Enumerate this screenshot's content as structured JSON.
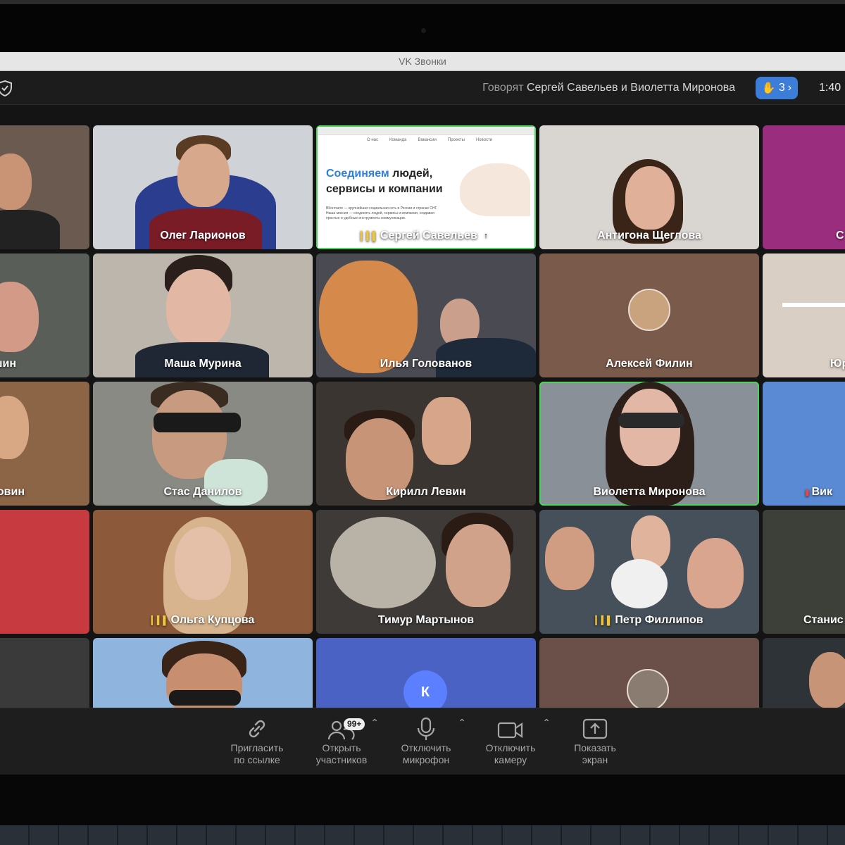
{
  "window": {
    "title": "VK Звонки"
  },
  "topbar": {
    "speaking_prefix": "Говорят",
    "speaking_names": "Сергей Савельев и Виолетта Миронова",
    "raised_hands_count": "3",
    "clock": "1:40"
  },
  "tiles": [
    {
      "name": "",
      "label": ""
    },
    {
      "name": "Олег Ларионов"
    },
    {
      "name": "Сергей Савельев",
      "sharing": true
    },
    {
      "name": "Антигона Щеглова"
    },
    {
      "name": "С"
    },
    {
      "name": "шин"
    },
    {
      "name": "Маша Мурина"
    },
    {
      "name": "Илья Голованов"
    },
    {
      "name": "Алексей Филин"
    },
    {
      "name": "Юр"
    },
    {
      "name": "овин"
    },
    {
      "name": "Стас Данилов"
    },
    {
      "name": "Кирилл Левин"
    },
    {
      "name": "Виолетта Миронова"
    },
    {
      "name": "Вик"
    },
    {
      "name": "Ольга Купцова"
    },
    {
      "name": "Тимур Мартынов"
    },
    {
      "name": "Петр Филлипов"
    },
    {
      "name": "Станис"
    },
    {
      "letter": "К"
    }
  ],
  "screen_share": {
    "headline_blue": "Соединяем",
    "headline_rest": " людей,",
    "headline_line2": "сервисы и компании",
    "body": "ВКонтакте — крупнейшая социальная сеть в России и странах СНГ. Наша миссия — соединять людей, сервисы и компании, создавая простые и удобные инструменты коммуникации.",
    "nav": [
      "О нас",
      "Команда",
      "Вакансии",
      "Проекты",
      "Новости"
    ]
  },
  "controls": {
    "invite": {
      "line1": "Пригласить",
      "line2": "по ссылке"
    },
    "participants": {
      "line1": "Открыть",
      "line2": "участников",
      "badge": "99+"
    },
    "mic": {
      "line1": "Отключить",
      "line2": "микрофон"
    },
    "camera": {
      "line1": "Отключить",
      "line2": "камеру"
    },
    "screen": {
      "line1": "Показать",
      "line2": "экран"
    }
  },
  "colors": {
    "accent": "#3b7dd8",
    "active_speaker": "#4bd35b",
    "tile_magenta": "#9b2d7e",
    "tile_red": "#c73a3f",
    "tile_blue": "#5a8ad4",
    "tile_brown": "#7a5a4a"
  }
}
